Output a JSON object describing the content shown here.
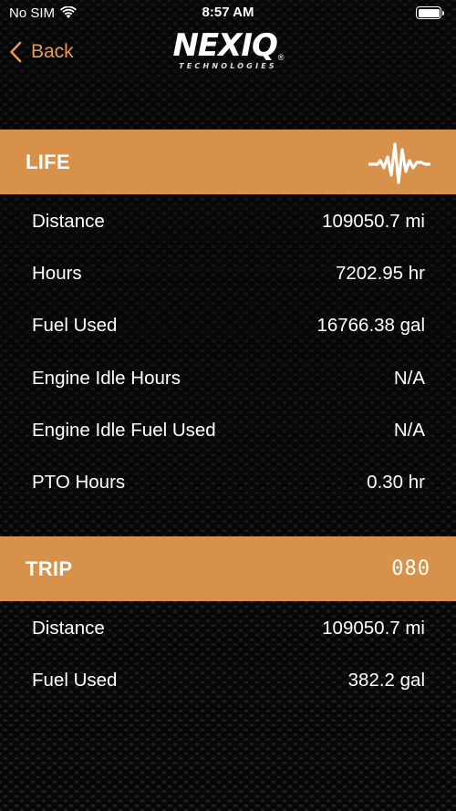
{
  "status_bar": {
    "carrier": "No SIM",
    "time": "8:57 AM",
    "wifi_icon": "wifi-icon",
    "battery_icon": "battery-icon",
    "battery_level": 1.0
  },
  "nav": {
    "back_label": "Back",
    "back_icon": "chevron-left-icon",
    "brand_name": "NEXIQ",
    "brand_tagline": "TECHNOLOGIES",
    "brand_reg": "®"
  },
  "colors": {
    "accent": "#e59a50",
    "header_bg": "#d8914a",
    "background": "#141414"
  },
  "life": {
    "title": "LIFE",
    "icon": "heartbeat-icon",
    "rows": [
      {
        "label": "Distance",
        "value": "109050.7 mi"
      },
      {
        "label": "Hours",
        "value": "7202.95 hr"
      },
      {
        "label": "Fuel Used",
        "value": "16766.38 gal"
      },
      {
        "label": "Engine Idle Hours",
        "value": "N/A"
      },
      {
        "label": "Engine Idle Fuel Used",
        "value": "N/A"
      },
      {
        "label": "PTO Hours",
        "value": "0.30 hr"
      }
    ]
  },
  "trip": {
    "title": "TRIP",
    "icon": "odometer-icon",
    "icon_text": "080",
    "rows": [
      {
        "label": "Distance",
        "value": "109050.7 mi"
      },
      {
        "label": "Fuel Used",
        "value": "382.2 gal"
      }
    ]
  }
}
